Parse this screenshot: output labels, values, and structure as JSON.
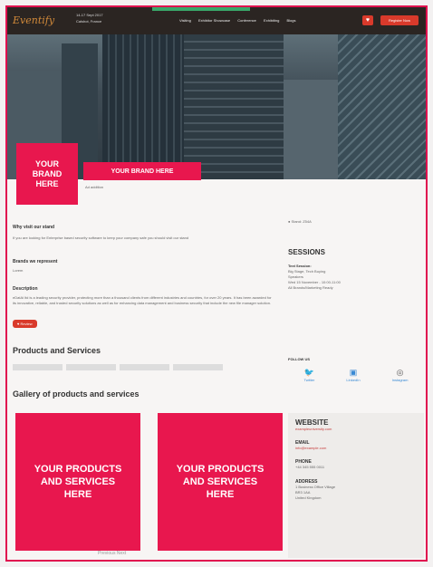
{
  "nav": {
    "logo": "Eventify",
    "event_line1": "14-17 Sept 2017",
    "event_line2": "Calshot, France",
    "menu": [
      "Visiting",
      "Exhibitor Showcase",
      "Conference",
      "Exhibiting",
      "Blogs"
    ],
    "register": "Register Now"
  },
  "brand": {
    "box_label": "YOUR\nBRAND\nHERE",
    "name_label": "YOUR BRAND HERE",
    "sub": "Ad addition"
  },
  "main": {
    "why_title": "Why visit our stand",
    "why_text": "If you are looking for Enterprise based security software to keep your company safe you should visit our stand",
    "brands_title": "Brands we represent",
    "brands_text": "Lorem",
    "desc_title": "Description",
    "desc_text": "eDatAi ltd is a leading security provider, protecting more than a thousand clients from different industries and countries, for over 20 years. It has been awarded for its innovative, reliable, and trusted security solutions as well as for enhancing data management and business security that include the new file manager solution.",
    "review_btn": "Review",
    "products_title": "Products and Services",
    "gallery_title": "Gallery of products and services",
    "product1": "YOUR PRODUCTS\nAND SERVICES\nHERE",
    "product2": "YOUR PRODUCTS\nAND SERVICES\nHERE"
  },
  "side": {
    "stand": "Stand: Z54A",
    "sessions_title": "SESSIONS",
    "session_name": "Text Session:",
    "session_line1": "Big Stage, Tech Buying",
    "session_line2": "Speakers",
    "session_line3": "Wed 15 November - 10:00-11:00",
    "session_line4": "All Brands/Marketing Ready",
    "follow_title": "FOLLOW US",
    "social": [
      "Twitter",
      "LinkedIn",
      "Instagram"
    ],
    "website_title": "WEBSITE",
    "website": "exampleuniversity.com",
    "email_label": "EMAIL",
    "email": "info@example.com",
    "phone_label": "PHONE",
    "phone": "+44 345 555 0011",
    "address_label": "ADDRESS",
    "address1": "1 Business Office Village",
    "address2": "BR3 1AA",
    "address3": "United Kingdom"
  },
  "pager": "Previous   Next"
}
